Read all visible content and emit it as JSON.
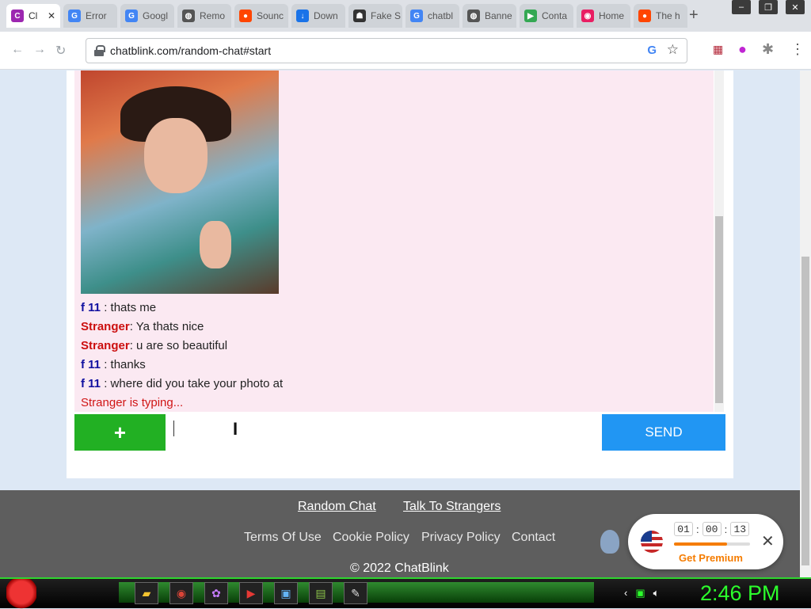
{
  "browser": {
    "tabs": [
      {
        "label": "Cl",
        "color": "#9c27b0",
        "glyph": "C",
        "active": true
      },
      {
        "label": "Error",
        "color": "#4285f4",
        "glyph": "G"
      },
      {
        "label": "Googl",
        "color": "#4285f4",
        "glyph": "G"
      },
      {
        "label": "Remo",
        "color": "#555555",
        "glyph": "◍"
      },
      {
        "label": "Sounc",
        "color": "#ff4500",
        "glyph": "●"
      },
      {
        "label": "Down",
        "color": "#1a73e8",
        "glyph": "↓"
      },
      {
        "label": "Fake S",
        "color": "#333333",
        "glyph": "☗"
      },
      {
        "label": "chatbl",
        "color": "#4285f4",
        "glyph": "G"
      },
      {
        "label": "Banne",
        "color": "#555555",
        "glyph": "◍"
      },
      {
        "label": "Conta",
        "color": "#34a853",
        "glyph": "▶"
      },
      {
        "label": "Home",
        "color": "#e91e63",
        "glyph": "◉"
      },
      {
        "label": "The h",
        "color": "#ff4500",
        "glyph": "●"
      }
    ],
    "new_tab": "+",
    "url": "chatblink.com/random-chat#start"
  },
  "chat": {
    "messages": [
      {
        "sender": "f 11",
        "sep": " : ",
        "text": "thats me",
        "type": "me"
      },
      {
        "sender": "Stranger",
        "sep": ": ",
        "text": "Ya thats nice",
        "type": "stranger"
      },
      {
        "sender": "Stranger",
        "sep": ": ",
        "text": "u are so beautiful",
        "type": "stranger"
      },
      {
        "sender": "f 11",
        "sep": " : ",
        "text": "thanks",
        "type": "me"
      },
      {
        "sender": "f 11",
        "sep": " : ",
        "text": "where did you take your photo at",
        "type": "me"
      }
    ],
    "typing_status": "Stranger is typing...",
    "plus_label": "+",
    "send_label": "SEND",
    "input_value": ""
  },
  "footer": {
    "links_primary": [
      "Random Chat",
      "Talk To Strangers"
    ],
    "links_secondary": [
      "Terms Of Use",
      "Cookie Policy",
      "Privacy Policy",
      "Contact"
    ],
    "copyright": "© 2022 ChatBlink"
  },
  "premium": {
    "timer": [
      "01",
      "00",
      "13"
    ],
    "progress": 0.7,
    "cta": "Get Premium"
  },
  "taskbar": {
    "clock": "2:46 PM"
  }
}
